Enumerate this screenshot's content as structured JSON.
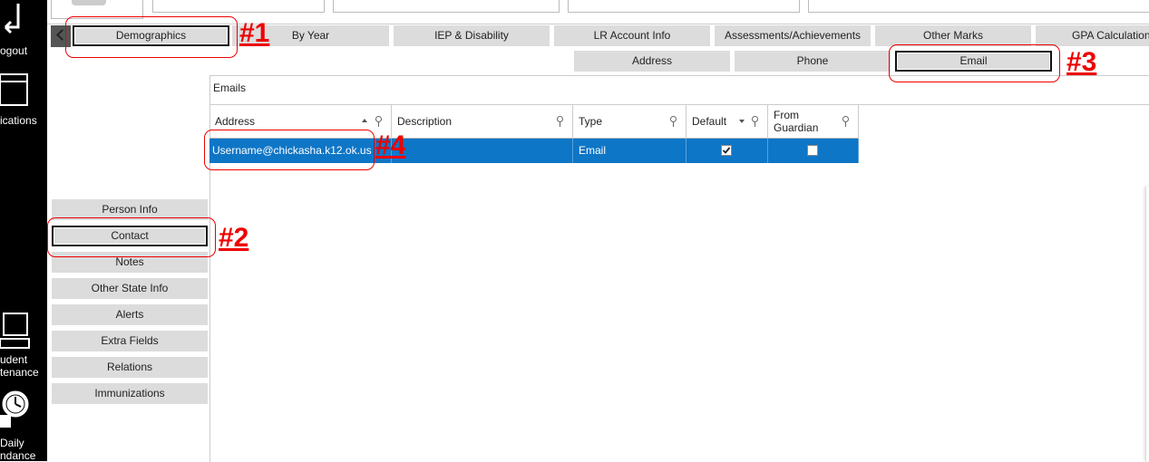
{
  "sidebar": {
    "logout_label": "ogout",
    "applications_label": "ications",
    "student_label_1": "udent",
    "student_label_2": "tenance",
    "daily_label_1": "Daily",
    "daily_label_2": "ndance"
  },
  "tabs_row1": [
    {
      "label": "Demographics"
    },
    {
      "label": "By Year"
    },
    {
      "label": "IEP & Disability"
    },
    {
      "label": "LR Account Info"
    },
    {
      "label": "Assessments/Achievements"
    },
    {
      "label": "Other Marks"
    },
    {
      "label": "GPA Calculation"
    }
  ],
  "tabs_row2": [
    {
      "label": "Address"
    },
    {
      "label": "Phone"
    },
    {
      "label": "Email"
    }
  ],
  "side_menu": [
    {
      "label": "Person Info"
    },
    {
      "label": "Contact"
    },
    {
      "label": "Notes"
    },
    {
      "label": "Other State Info"
    },
    {
      "label": "Alerts"
    },
    {
      "label": "Extra Fields"
    },
    {
      "label": "Relations"
    },
    {
      "label": "Immunizations"
    }
  ],
  "emails": {
    "section_title": "Emails",
    "columns": [
      "Address",
      "Description",
      "Type",
      "Default",
      "From",
      "Guardian"
    ],
    "rows": [
      {
        "address": "Username@chickasha.k12.ok.us",
        "description": "",
        "type": "Email",
        "default": true,
        "from_guardian": false
      }
    ]
  },
  "annotations": {
    "a1": "#1",
    "a2": "#2",
    "a3": "#3",
    "a4": "#4",
    "color": "#e00000"
  }
}
